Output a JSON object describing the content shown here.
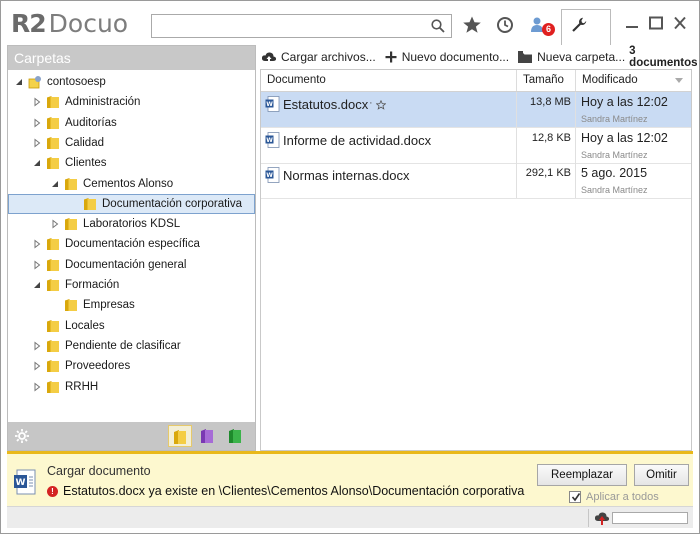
{
  "app": {
    "logo_r2": "R2",
    "logo_name": "Docuo"
  },
  "search": {
    "value": "",
    "placeholder": ""
  },
  "header": {
    "notification_count": "6"
  },
  "left": {
    "title": "Carpetas",
    "tree": [
      {
        "label": "contosoesp",
        "level": 0,
        "expander": "expanded",
        "icon": "site-icon"
      },
      {
        "label": "Administración",
        "level": 1,
        "expander": "collapsed",
        "icon": "folder-icon"
      },
      {
        "label": "Auditorías",
        "level": 1,
        "expander": "collapsed",
        "icon": "folder-icon"
      },
      {
        "label": "Calidad",
        "level": 1,
        "expander": "collapsed",
        "icon": "folder-icon"
      },
      {
        "label": "Clientes",
        "level": 1,
        "expander": "expanded",
        "icon": "folder-icon"
      },
      {
        "label": "Cementos Alonso",
        "level": 2,
        "expander": "expanded",
        "icon": "folder-icon"
      },
      {
        "label": "Documentación corporativa",
        "level": 3,
        "expander": "none",
        "icon": "folder-open-icon",
        "selected": true
      },
      {
        "label": "Laboratorios KDSL",
        "level": 2,
        "expander": "collapsed",
        "icon": "folder-icon"
      },
      {
        "label": "Documentación específica",
        "level": 1,
        "expander": "collapsed",
        "icon": "folder-icon"
      },
      {
        "label": "Documentación general",
        "level": 1,
        "expander": "collapsed",
        "icon": "folder-icon"
      },
      {
        "label": "Formación",
        "level": 1,
        "expander": "expanded",
        "icon": "folder-icon"
      },
      {
        "label": "Empresas",
        "level": 2,
        "expander": "none",
        "icon": "folder-icon"
      },
      {
        "label": "Locales",
        "level": 1,
        "expander": "none",
        "icon": "folder-icon"
      },
      {
        "label": "Pendiente de clasificar",
        "level": 1,
        "expander": "collapsed",
        "icon": "folder-icon"
      },
      {
        "label": "Proveedores",
        "level": 1,
        "expander": "collapsed",
        "icon": "folder-icon"
      },
      {
        "label": "RRHH",
        "level": 1,
        "expander": "collapsed",
        "icon": "folder-icon"
      }
    ]
  },
  "toolbar": {
    "upload_label": "Cargar archivos...",
    "new_doc_label": "Nuevo documento...",
    "new_folder_label": "Nueva carpeta...",
    "doc_count": "3 documentos"
  },
  "table": {
    "headers": {
      "name": "Documento",
      "size": "Tamaño",
      "modified": "Modificado"
    },
    "rows": [
      {
        "name": "Estatutos.docx",
        "size": "13,8 MB",
        "date": "Hoy a las 12:02",
        "user": "Sandra Martínez",
        "selected": true
      },
      {
        "name": "Informe de actividad.docx",
        "size": "12,8 KB",
        "date": "Hoy a las 12:02",
        "user": "Sandra Martínez"
      },
      {
        "name": "Normas internas.docx",
        "size": "292,1 KB",
        "date": "5 ago. 2015",
        "user": "Sandra Martínez"
      }
    ]
  },
  "notification": {
    "title": "Cargar documento",
    "message": "Estatutos.docx ya existe en \\Clientes\\Cementos Alonso\\Documentación corporativa",
    "replace_label": "Reemplazar",
    "skip_label": "Omitir",
    "apply_all_label": "Aplicar a todos",
    "apply_all_checked": true
  },
  "colors": {
    "accent": "#e9b81a",
    "selection": "#c9dbf3",
    "folder": "#f0c419"
  }
}
